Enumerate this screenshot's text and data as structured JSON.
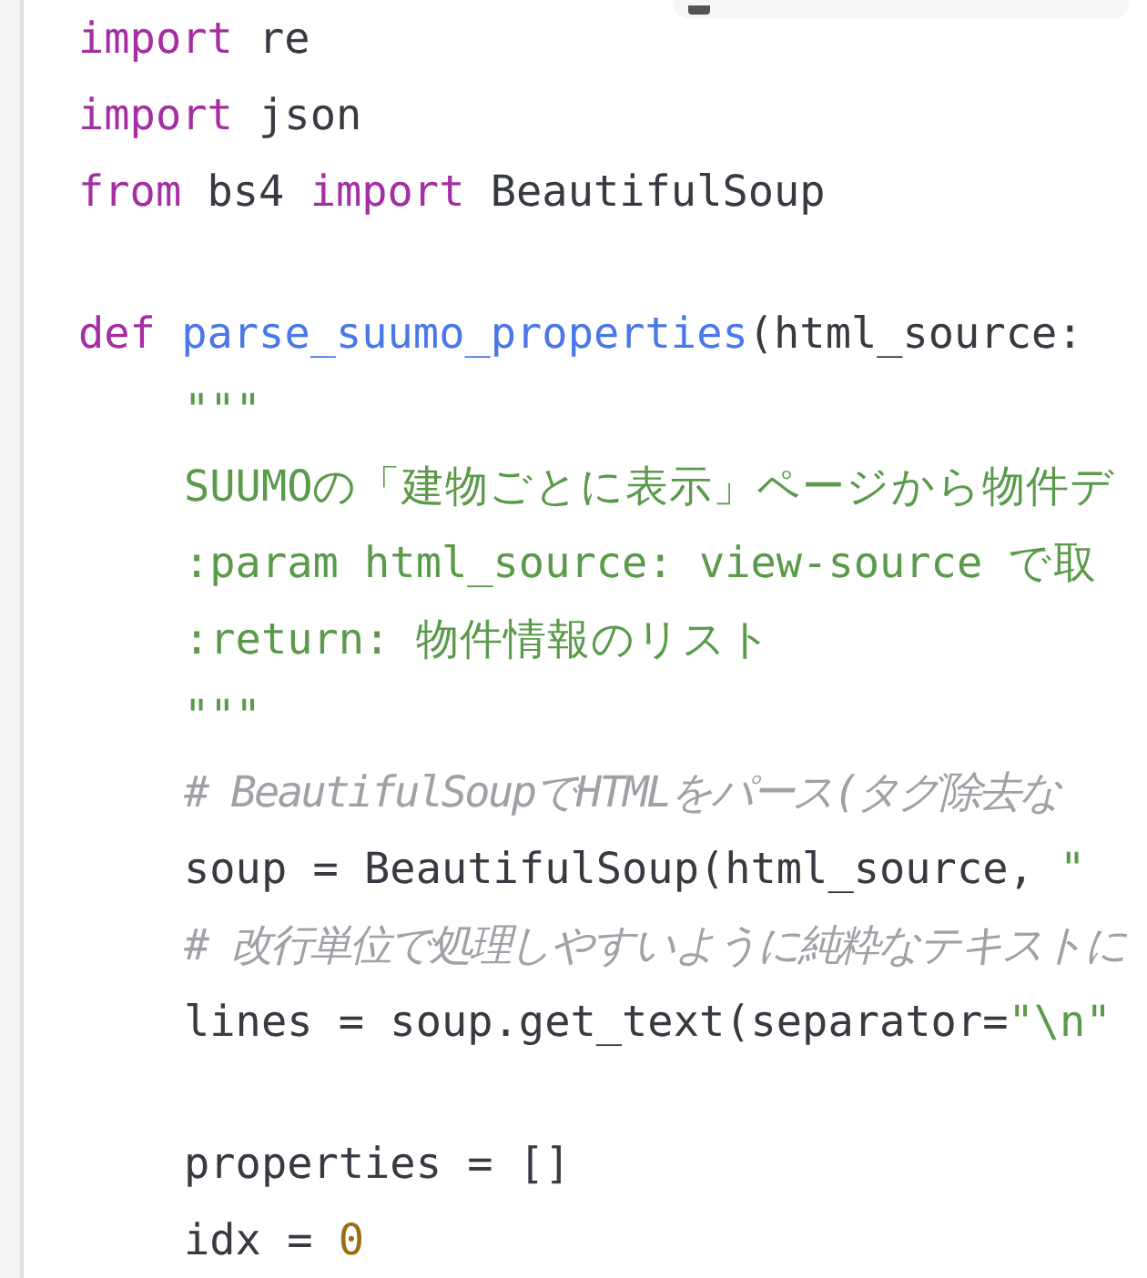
{
  "editor": {
    "lines": [
      {
        "kind": "code",
        "indented": false,
        "tokens": [
          {
            "kind": "keyword",
            "text": "import"
          },
          {
            "kind": "plain",
            "text": " re"
          }
        ]
      },
      {
        "kind": "code",
        "indented": false,
        "tokens": [
          {
            "kind": "keyword",
            "text": "import"
          },
          {
            "kind": "plain",
            "text": " json"
          }
        ]
      },
      {
        "kind": "code",
        "indented": false,
        "tokens": [
          {
            "kind": "keyword",
            "text": "from"
          },
          {
            "kind": "plain",
            "text": " bs4 "
          },
          {
            "kind": "keyword",
            "text": "import"
          },
          {
            "kind": "plain",
            "text": " BeautifulSoup"
          }
        ]
      },
      {
        "kind": "blank"
      },
      {
        "kind": "code",
        "indented": false,
        "tokens": [
          {
            "kind": "keyword",
            "text": "def"
          },
          {
            "kind": "function",
            "text": " parse_suumo_properties"
          },
          {
            "kind": "plain",
            "text": "(html_source:"
          }
        ]
      },
      {
        "kind": "code",
        "indented": true,
        "tokens": [
          {
            "kind": "string",
            "text": "\"\"\""
          }
        ]
      },
      {
        "kind": "code",
        "indented": true,
        "tokens": [
          {
            "kind": "string",
            "text": "SUUMOの「建物ごとに表示」ページから物件デ"
          }
        ]
      },
      {
        "kind": "code",
        "indented": true,
        "tokens": [
          {
            "kind": "string",
            "text": ":param html_source: view-source で取"
          }
        ]
      },
      {
        "kind": "code",
        "indented": true,
        "tokens": [
          {
            "kind": "string",
            "text": ":return: 物件情報のリスト"
          }
        ]
      },
      {
        "kind": "code",
        "indented": true,
        "tokens": [
          {
            "kind": "string",
            "text": "\"\"\""
          }
        ]
      },
      {
        "kind": "code",
        "indented": true,
        "tokens": [
          {
            "kind": "comment",
            "text": "# BeautifulSoupでHTMLをパース(タグ除去な"
          }
        ]
      },
      {
        "kind": "code",
        "indented": true,
        "tokens": [
          {
            "kind": "plain",
            "text": "soup = BeautifulSoup(html_source, "
          },
          {
            "kind": "string",
            "text": "\""
          }
        ]
      },
      {
        "kind": "code",
        "indented": true,
        "tokens": [
          {
            "kind": "comment",
            "text": "# 改行単位で処理しやすいように純粋なテキストに"
          }
        ]
      },
      {
        "kind": "code",
        "indented": true,
        "tokens": [
          {
            "kind": "plain",
            "text": "lines = soup.get_text(separator="
          },
          {
            "kind": "string",
            "text": "\"\\n\""
          }
        ]
      },
      {
        "kind": "blank"
      },
      {
        "kind": "code",
        "indented": true,
        "tokens": [
          {
            "kind": "plain",
            "text": "properties = []"
          }
        ]
      },
      {
        "kind": "code",
        "indented": true,
        "tokens": [
          {
            "kind": "plain",
            "text": "idx = "
          },
          {
            "kind": "number",
            "text": "0"
          }
        ]
      }
    ]
  }
}
